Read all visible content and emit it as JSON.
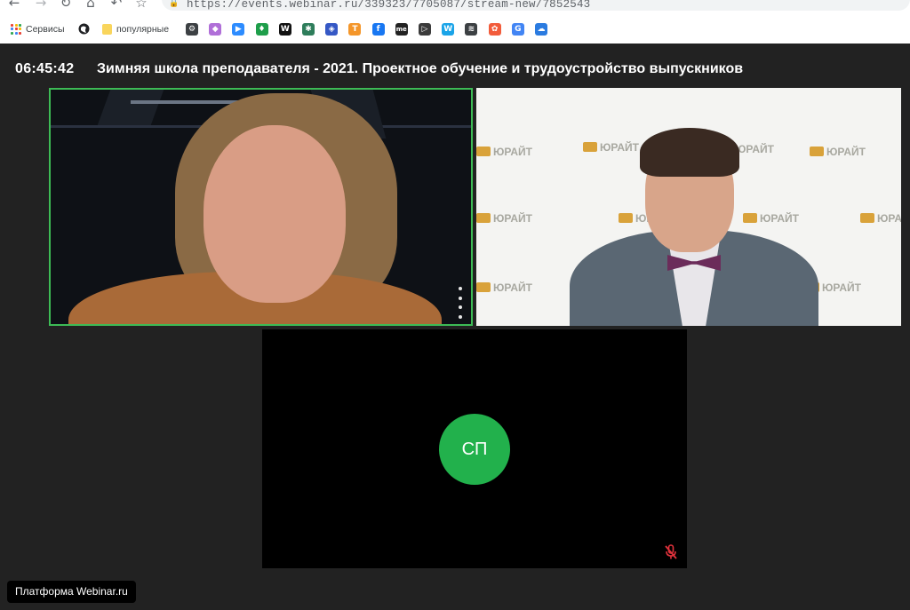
{
  "browser": {
    "url": "https://events.webinar.ru/339323/7705087/stream-new/7852543",
    "nav": {
      "back": "←",
      "forward": "→",
      "reload": "↻",
      "home": "⌂",
      "undo": "↶",
      "star": "☆"
    },
    "bookmarks": {
      "services": "Сервисы",
      "popular": "популярные",
      "icons": [
        {
          "name": "gear-icon",
          "glyph": "⚙",
          "color": "#3c4043"
        },
        {
          "name": "colorful-app-icon",
          "glyph": "◆",
          "color": "#b06fd8"
        },
        {
          "name": "zoom-icon",
          "glyph": "▶",
          "color": "#2d8cff"
        },
        {
          "name": "mic-app-icon",
          "glyph": "♦",
          "color": "#1e9e4a"
        },
        {
          "name": "wikipedia-icon",
          "glyph": "W",
          "color": "#111111"
        },
        {
          "name": "green-grid-icon",
          "glyph": "✱",
          "color": "#2e7d5b"
        },
        {
          "name": "blue-shield-icon",
          "glyph": "◈",
          "color": "#3558c5"
        },
        {
          "name": "orange-t-icon",
          "glyph": "T",
          "color": "#f4962a"
        },
        {
          "name": "facebook-icon",
          "glyph": "f",
          "color": "#1877f2"
        },
        {
          "name": "me-icon",
          "glyph": "me",
          "color": "#222222"
        },
        {
          "name": "play-ring-icon",
          "glyph": "▷",
          "color": "#3b3b3b"
        },
        {
          "name": "w-brand-icon",
          "glyph": "W",
          "color": "#1aa4e8"
        },
        {
          "name": "waveform-icon",
          "glyph": "≋",
          "color": "#3c4043"
        },
        {
          "name": "flower-icon",
          "glyph": "✿",
          "color": "#f25c3b"
        },
        {
          "name": "google-icon",
          "glyph": "G",
          "color": "#4285f4"
        },
        {
          "name": "cloud-icon",
          "glyph": "☁",
          "color": "#2b7be0"
        }
      ]
    }
  },
  "meeting": {
    "timer": "06:45:42",
    "title": "Зимняя школа преподавателя - 2021. Проектное обучение и трудоустройство выпускников",
    "avatar_initials": "СП",
    "platform_label": "Платформа Webinar.ru",
    "active_speaker_color": "#3dbb55",
    "avatar_color": "#22b14c",
    "mic_muted_color": "#e0323c"
  },
  "backdrop": {
    "logo_text": "ЮРАЙТ"
  }
}
